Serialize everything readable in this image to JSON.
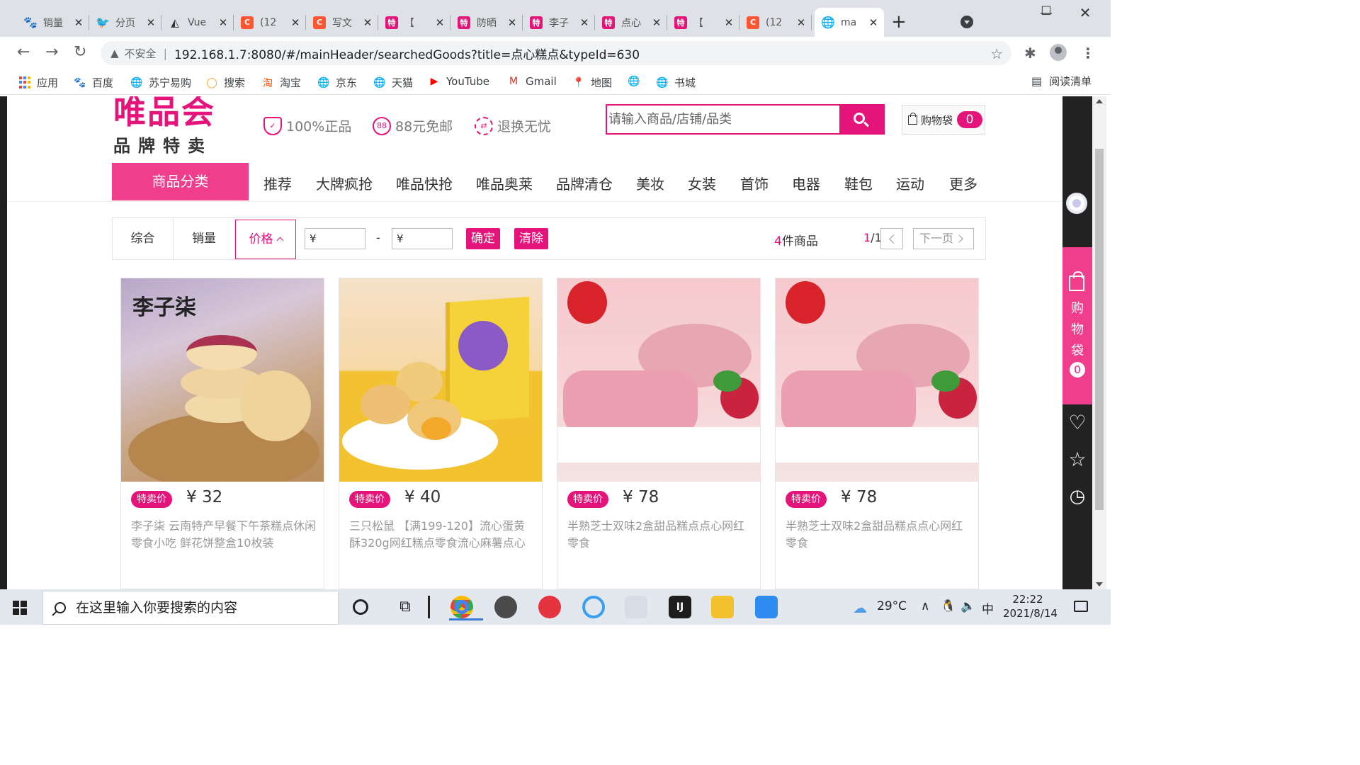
{
  "browser": {
    "tabs": [
      {
        "title": "销量",
        "icon": "paw-icon",
        "glyph": "🐾",
        "cls": "paw"
      },
      {
        "title": "分页",
        "icon": "bird-icon",
        "glyph": "🐦",
        "cls": "bird"
      },
      {
        "title": "Vue",
        "icon": "vue-icon",
        "glyph": "◭",
        "cls": "vue"
      },
      {
        "title": "(12",
        "icon": "csdn-icon",
        "glyph": "C",
        "cls": "csdn"
      },
      {
        "title": "写文",
        "icon": "csdn-icon",
        "glyph": "C",
        "cls": "csdn"
      },
      {
        "title": "【",
        "icon": "te-icon",
        "glyph": "特",
        "cls": "te"
      },
      {
        "title": "防晒",
        "icon": "te-icon",
        "glyph": "特",
        "cls": "te"
      },
      {
        "title": "李子",
        "icon": "te-icon",
        "glyph": "特",
        "cls": "te"
      },
      {
        "title": "点心",
        "icon": "te-icon",
        "glyph": "特",
        "cls": "te"
      },
      {
        "title": "【",
        "icon": "te-icon",
        "glyph": "特",
        "cls": "te"
      },
      {
        "title": "(12",
        "icon": "csdn-icon",
        "glyph": "C",
        "cls": "csdn"
      }
    ],
    "active_tab": {
      "title": "ma",
      "icon": "globe-icon",
      "glyph": "🌐"
    },
    "new_tab": "+",
    "security_label": "不安全",
    "url": "192.168.1.7:8080/#/mainHeader/searchedGoods?title=点心糕点&typeId=630",
    "bookmarks": [
      {
        "label": "应用",
        "icon": "apps-icon"
      },
      {
        "label": "百度",
        "icon": "baidu-icon",
        "glyph": "🐾",
        "color": "#2932e1"
      },
      {
        "label": "苏宁易购",
        "icon": "globe-icon",
        "glyph": "🌐",
        "color": "#5f6368"
      },
      {
        "label": "搜索",
        "icon": "search-o-icon",
        "glyph": "◯",
        "color": "#f5a623"
      },
      {
        "label": "淘宝",
        "icon": "taobao-icon",
        "glyph": "淘",
        "color": "#ff5000"
      },
      {
        "label": "京东",
        "icon": "globe-icon",
        "glyph": "🌐",
        "color": "#5f6368"
      },
      {
        "label": "天猫",
        "icon": "globe-icon",
        "glyph": "🌐",
        "color": "#5f6368"
      },
      {
        "label": "YouTube",
        "icon": "youtube-icon",
        "glyph": "▶",
        "color": "#ff0000"
      },
      {
        "label": "Gmail",
        "icon": "gmail-icon",
        "glyph": "M",
        "color": "#d93025"
      },
      {
        "label": "地图",
        "icon": "maps-icon",
        "glyph": "📍",
        "color": "#34a853"
      },
      {
        "label": "",
        "icon": "globe-icon",
        "glyph": "🌐",
        "color": "#5f6368"
      },
      {
        "label": "书城",
        "icon": "globe-icon",
        "glyph": "🌐",
        "color": "#5f6368"
      }
    ],
    "reading_list": "阅读清单"
  },
  "site": {
    "logo_main": "唯品会",
    "logo_sub": "品牌特卖",
    "promises": [
      {
        "label": "100%正品",
        "icon": "shield-icon",
        "shape": "shield",
        "glyph": "✓"
      },
      {
        "label": "88元免邮",
        "icon": "free-shipping-icon",
        "shape": "circle",
        "glyph": "88"
      },
      {
        "label": "退换无忧",
        "icon": "exchange-icon",
        "shape": "swap",
        "glyph": "⇄"
      }
    ],
    "search_placeholder": "请输入商品/店铺/品类",
    "cart_label": "购物袋",
    "cart_count": "0",
    "category_button": "商品分类",
    "nav": [
      "推荐",
      "大牌疯抢",
      "唯品快抢",
      "唯品奥莱",
      "品牌清仓",
      "美妆",
      "女装",
      "首饰",
      "电器",
      "鞋包",
      "运动",
      "更多"
    ]
  },
  "filter": {
    "sort_overall": "综合",
    "sort_sales": "销量",
    "sort_price": "价格",
    "min_price": "¥",
    "max_price": "¥",
    "dash": "-",
    "confirm": "确定",
    "clear": "清除",
    "count_num": "4",
    "count_suffix": "件商品",
    "page_current": "1",
    "page_total": "/1",
    "next_page": "下一页"
  },
  "products": [
    {
      "badge": "特卖价",
      "price": "¥ 32",
      "title": "李子柒 云南特产早餐下午茶糕点休闲零食小吃 鲜花饼整盒10枚装",
      "brand_mark": "李子柒"
    },
    {
      "badge": "特卖价",
      "price": "¥ 40",
      "title": "三只松鼠 【满199-120】流心蛋黄酥320g网红糕点零食流心麻薯点心"
    },
    {
      "badge": "特卖价",
      "price": "¥ 78",
      "title": "半熟芝士双味2盒甜品糕点点心网红零食"
    },
    {
      "badge": "特卖价",
      "price": "¥ 78",
      "title": "半熟芝士双味2盒甜品糕点点心网红零食"
    }
  ],
  "sidebar": {
    "cart_text": "购物袋",
    "cart_count": "0"
  },
  "taskbar": {
    "search_placeholder": "在这里输入你要搜索的内容",
    "weather": "29°C",
    "ime": "中",
    "time": "22:22",
    "date": "2021/8/14"
  }
}
